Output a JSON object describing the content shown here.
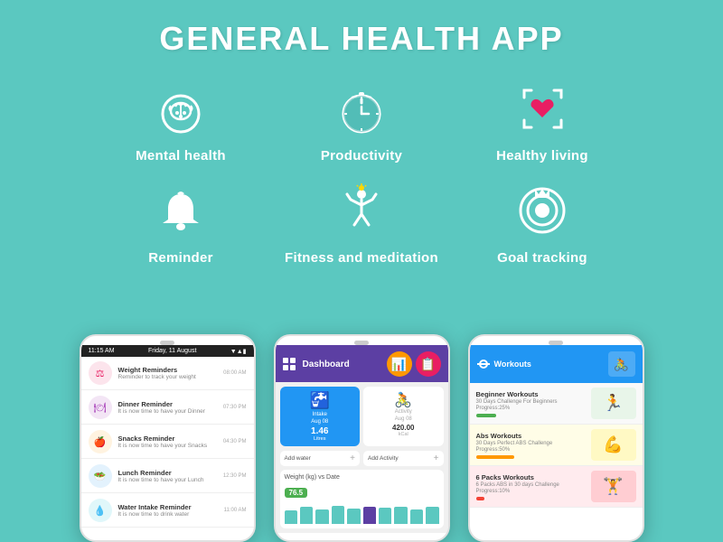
{
  "app": {
    "title": "GENERAL HEALTH APP"
  },
  "features": {
    "row1": [
      {
        "id": "mental-health",
        "label": "Mental health",
        "icon": "brain"
      },
      {
        "id": "productivity",
        "label": "Productivity",
        "icon": "clock"
      },
      {
        "id": "healthy-living",
        "label": "Healthy living",
        "icon": "heart-scan"
      }
    ],
    "row2": [
      {
        "id": "reminder",
        "label": "Reminder",
        "icon": "bell"
      },
      {
        "id": "fitness-meditation",
        "label": "Fitness and meditation",
        "icon": "figure"
      },
      {
        "id": "goal-tracking",
        "label": "Goal tracking",
        "icon": "target"
      }
    ]
  },
  "phone1": {
    "statusbar": {
      "time": "11:15 AM",
      "date": "Friday, 11 August"
    },
    "reminders": [
      {
        "title": "Weight Reminders",
        "sub": "Reminder to track your weight",
        "time": "08:00 AM",
        "color": "#E91E63"
      },
      {
        "title": "Dinner Reminder",
        "sub": "It is now time to have your Dinner",
        "time": "07:30 PM",
        "color": "#9C27B0"
      },
      {
        "title": "Snacks Reminder",
        "sub": "It is now time to have your Snacks",
        "time": "04:30 PM",
        "color": "#FF9800"
      },
      {
        "title": "Lunch Reminder",
        "sub": "It is now time to have your Lunch",
        "time": "12:30 PM",
        "color": "#2196F3"
      },
      {
        "title": "Water Intake Reminder",
        "sub": "It is now time to drink water",
        "time": "11:00 AM",
        "color": "#00BCD4"
      }
    ]
  },
  "phone2": {
    "header": "Dashboard",
    "intake": {
      "label": "Intake",
      "value": "1.46",
      "unit": "Litres",
      "date": "Aug 08"
    },
    "activity": {
      "label": "Activity",
      "value": "420.00",
      "unit": "kCal",
      "date": "Aug 08"
    },
    "addWater": "Add water",
    "addActivity": "Add Activity",
    "weightChart": {
      "title": "Weight (kg) vs Date",
      "value": "76.5",
      "bars": [
        60,
        75,
        65,
        80,
        70,
        76,
        72,
        78,
        65,
        76
      ]
    }
  },
  "phone3": {
    "header": "Workouts",
    "workouts": [
      {
        "name": "Beginner Workouts",
        "sub": "30 Days Challenge For Beginners",
        "progress": "25%",
        "progressNum": 25,
        "color": "#4CAF50"
      },
      {
        "name": "Abs Workouts",
        "sub": "30 Days Perfect ABS Challenge",
        "progress": "50%",
        "progressNum": 50,
        "color": "#FF9800"
      },
      {
        "name": "6 Packs Workouts",
        "sub": "6 Packs ABS in 30 days Challenge",
        "progress": "10%",
        "progressNum": 10,
        "color": "#f44336"
      }
    ]
  },
  "colors": {
    "bg": "#5bc8c0",
    "white": "#ffffff",
    "featureLabel": "#ffffff",
    "phone2Header": "#5c3fa3"
  }
}
